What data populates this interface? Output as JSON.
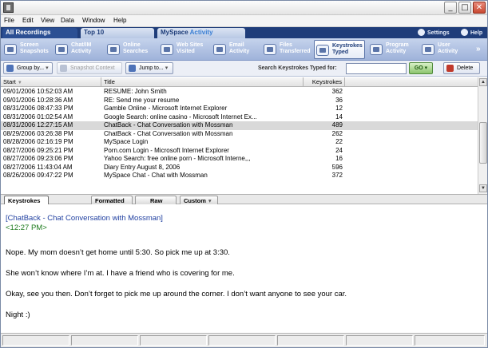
{
  "menubar": [
    "File",
    "Edit",
    "View",
    "Data",
    "Window",
    "Help"
  ],
  "tabs": [
    {
      "label": "All Recordings"
    },
    {
      "label": "Top 10"
    },
    {
      "label": "MySpace",
      "accent": "Activity"
    }
  ],
  "header_links": {
    "settings": "Settings",
    "help": "Help"
  },
  "categories": [
    {
      "line1": "Screen",
      "line2": "Snapshots",
      "icon": "camera-icon"
    },
    {
      "line1": "Chat/IM",
      "line2": "Activity",
      "icon": "chat-icon"
    },
    {
      "line1": "Online",
      "line2": "Searches",
      "icon": "magnifier-icon"
    },
    {
      "line1": "Web Sites",
      "line2": "Visited",
      "icon": "globe-icon"
    },
    {
      "line1": "Email",
      "line2": "Activity",
      "icon": "envelope-icon"
    },
    {
      "line1": "Files",
      "line2": "Transferred",
      "icon": "folder-icon"
    },
    {
      "line1": "Keystrokes",
      "line2": "Typed",
      "icon": "keyboard-icon"
    },
    {
      "line1": "Program",
      "line2": "Activity",
      "icon": "program-icon"
    },
    {
      "line1": "User",
      "line2": "Activity",
      "icon": "user-icon"
    }
  ],
  "actions": {
    "group_by": "Group by...",
    "snapshot_context": "Snapshot Context",
    "jump_to": "Jump to...",
    "search_label": "Search Keystrokes Typed for:",
    "search_value": "",
    "go": "GO",
    "delete": "Delete"
  },
  "table": {
    "columns": {
      "start": "Start",
      "title": "Title",
      "keys": "Keystrokes"
    },
    "rows": [
      {
        "start": "09/01/2006  10:52:03 AM",
        "title": "RESUME: John Smith",
        "keys": "362"
      },
      {
        "start": "09/01/2006  10:28:36 AM",
        "title": "RE: Send me your resume",
        "keys": "36"
      },
      {
        "start": "08/31/2006  08:47:33 PM",
        "title": "Gamble Online - Microsoft Internet Explorer",
        "keys": "12"
      },
      {
        "start": "08/31/2006  01:02:54 AM",
        "title": "Google Search: online casino - Microsoft Internet Ex...",
        "keys": "14"
      },
      {
        "start": "08/31/2006  12:27:15 AM",
        "title": "ChatBack - Chat Conversation with Mossman",
        "keys": "489",
        "selected": true
      },
      {
        "start": "08/29/2006  03:26:38 PM",
        "title": "ChatBack - Chat Conversation with Mossman",
        "keys": "262"
      },
      {
        "start": "08/28/2006  02:16:19 PM",
        "title": "MySpace Login",
        "keys": "22"
      },
      {
        "start": "08/27/2006  09:25:21 PM",
        "title": "Porn.com Login - Microsoft Internet Explorer",
        "keys": "24"
      },
      {
        "start": "08/27/2006  09:23:06 PM",
        "title": "Yahoo Search: free online porn - Microsoft Interne,,,",
        "keys": "16"
      },
      {
        "start": "08/27/2006  11:43:04 AM",
        "title": "Diary Entry August 8, 2006",
        "keys": "596"
      },
      {
        "start": "08/26/2006  09:47:22 PM",
        "title": "MySpace Chat - Chat with Mossman",
        "keys": "372"
      }
    ]
  },
  "view_tabs": [
    "Keystrokes",
    "Formatted",
    "Raw",
    "Custom"
  ],
  "detail": {
    "title": "[ChatBack - Chat Conversation with Mossman]",
    "time": "<12:27 PM>",
    "lines": [
      "Nope.  My mom doesn’t get home until 5:30.  So pick me up at 3:30.",
      "She won’t know where I’m at.  I have a friend who is covering for me.",
      "Okay, see you then.  Don’t forget to pick me up around the corner.  I don’t want anyone to see your car.",
      "Night :)"
    ]
  },
  "colors": {
    "selection_row": "#d9d9d9",
    "tab_strip": "#1f3d7a",
    "title_link": "#1f3fa0",
    "time_green": "#1c7a1c"
  }
}
